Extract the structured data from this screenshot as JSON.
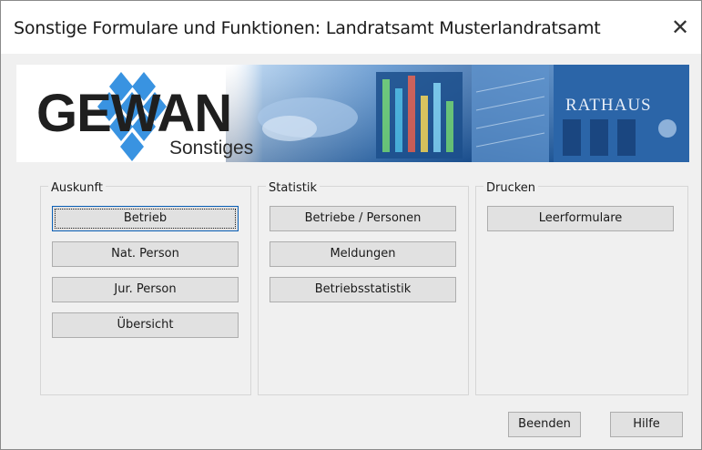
{
  "window": {
    "title": "Sonstige Formulare und Funktionen: Landratsamt Musterlandratsamt",
    "close_glyph": "✕"
  },
  "banner": {
    "logo_text": "GEWAN",
    "logo_sub": "Sonstiges",
    "photo_sign": "RATHAUS"
  },
  "groups": {
    "auskunft": {
      "label": "Auskunft",
      "buttons": [
        "Betrieb",
        "Nat. Person",
        "Jur. Person",
        "Übersicht"
      ]
    },
    "statistik": {
      "label": "Statistik",
      "buttons": [
        "Betriebe / Personen",
        "Meldungen",
        "Betriebsstatistik"
      ]
    },
    "drucken": {
      "label": "Drucken",
      "buttons": [
        "Leerformulare"
      ]
    }
  },
  "footer": {
    "beenden": "Beenden",
    "hilfe": "Hilfe"
  },
  "colors": {
    "dialog_bg": "#f0f0f0",
    "button_bg": "#e1e1e1",
    "focus_border": "#0a5fb6",
    "logo_diamond": "#2f8ee0"
  }
}
